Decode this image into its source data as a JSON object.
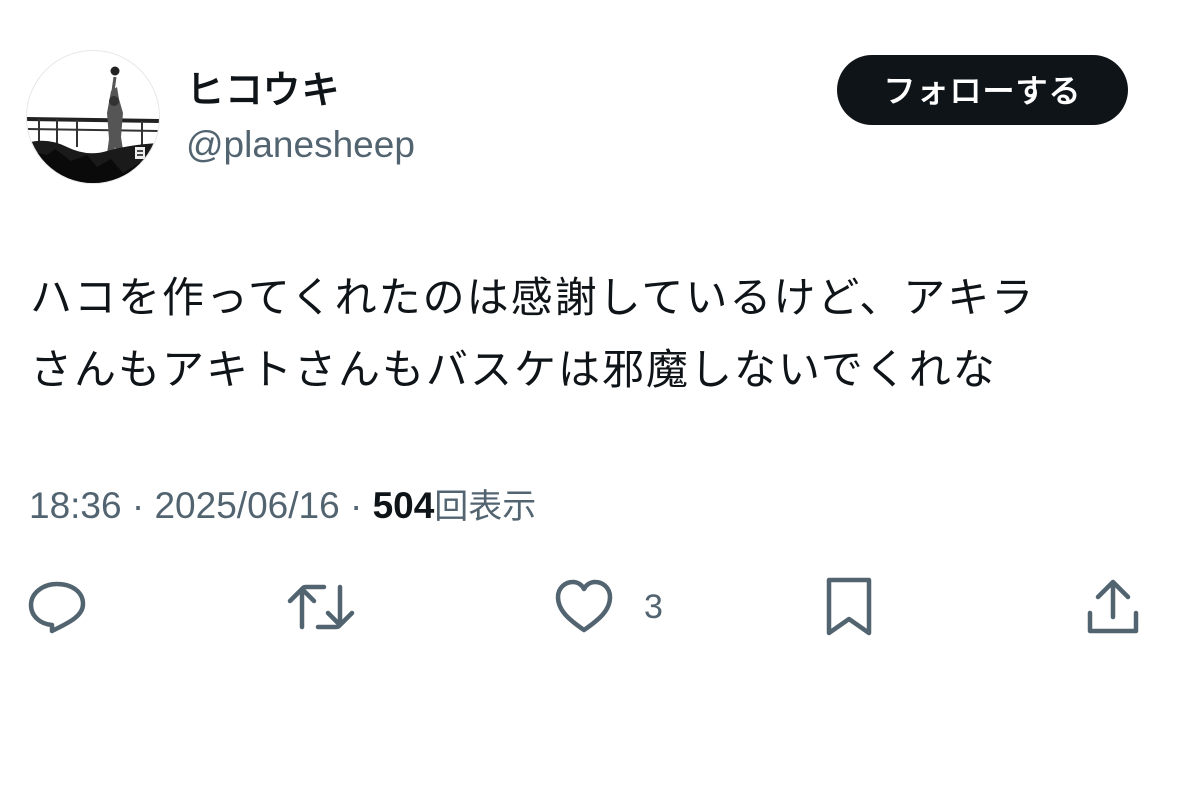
{
  "author": {
    "display_name": "ヒコウキ",
    "handle": "@planesheep",
    "avatar_icon": "avatar-photo"
  },
  "follow_button": {
    "label": "フォローする"
  },
  "tweet": {
    "lines": [
      "ハコを作ってくれたのは感謝しているけど、アキラ",
      "さんもアキトさんもバスケは邪魔しないでくれな"
    ]
  },
  "meta": {
    "time": "18:36",
    "separator": "·",
    "date": "2025/06/16",
    "views_count": "504",
    "views_label": "回表示"
  },
  "actions": {
    "reply_icon": "reply-icon",
    "retweet_icon": "retweet-icon",
    "like_icon": "heart-icon",
    "like_count": "3",
    "bookmark_icon": "bookmark-icon",
    "share_icon": "share-icon"
  },
  "colors": {
    "text_primary": "#0f1419",
    "text_secondary": "#536471",
    "button_bg": "#0f1419",
    "button_text": "#ffffff",
    "background": "#ffffff"
  }
}
